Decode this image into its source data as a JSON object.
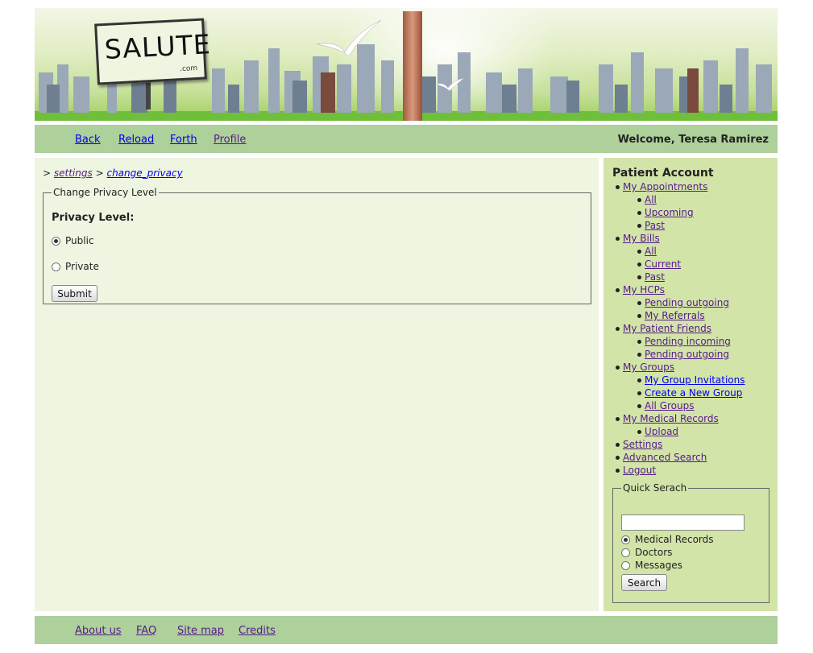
{
  "header": {
    "logo_text": "SALUTE",
    "logo_suffix": ".com"
  },
  "nav": {
    "back": "Back",
    "reload": "Reload",
    "forth": "Forth",
    "profile": "Profile",
    "welcome": "Welcome, Teresa Ramirez"
  },
  "breadcrumb": {
    "sep": ">",
    "settings": "settings",
    "current": "change_privacy"
  },
  "privacy_form": {
    "legend": "Change Privacy Level",
    "label": "Privacy Level:",
    "options": [
      {
        "label": "Public",
        "checked": true
      },
      {
        "label": "Private",
        "checked": false
      }
    ],
    "submit": "Submit"
  },
  "sidebar": {
    "title": "Patient Account",
    "appointments": {
      "label": "My Appointments",
      "items": [
        "All",
        "Upcoming",
        "Past"
      ]
    },
    "bills": {
      "label": "My Bills",
      "items": [
        "All",
        "Current",
        "Past"
      ]
    },
    "hcps": {
      "label": "My HCPs",
      "items": [
        "Pending outgoing",
        "My Referrals"
      ]
    },
    "friends": {
      "label": "My Patient Friends",
      "items": [
        "Pending incoming",
        "Pending outgoing"
      ]
    },
    "groups": {
      "label": "My Groups",
      "items": [
        "My Group Invitations",
        "Create a New Group",
        "All Groups"
      ]
    },
    "records": {
      "label": "My Medical Records",
      "items": [
        "Upload"
      ]
    },
    "settings": "Settings",
    "advanced_search": "Advanced Search",
    "logout": "Logout"
  },
  "quick_search": {
    "legend": "Quick Serach",
    "input_value": "",
    "options": [
      {
        "label": "Medical Records",
        "checked": true
      },
      {
        "label": "Doctors",
        "checked": false
      },
      {
        "label": "Messages",
        "checked": false
      }
    ],
    "button": "Search"
  },
  "footer": {
    "about": "About us",
    "faq": "FAQ",
    "sitemap": "Site map",
    "credits": "Credits"
  }
}
